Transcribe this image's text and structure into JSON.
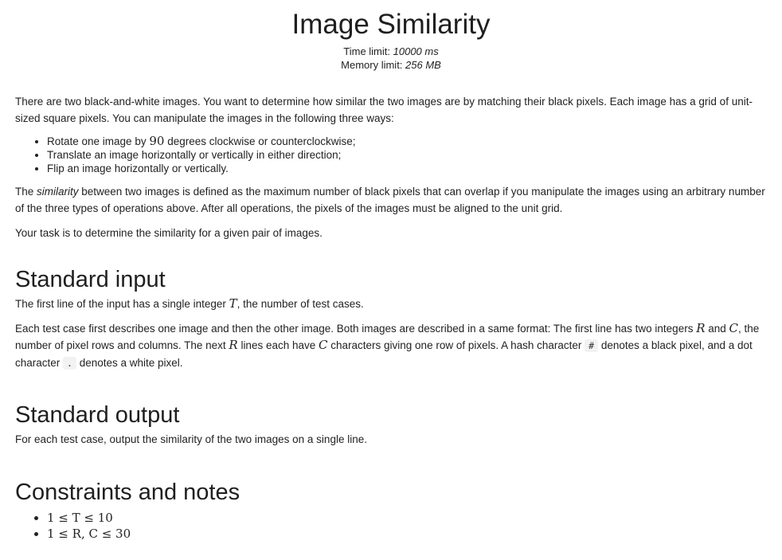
{
  "title": "Image Similarity",
  "limits": {
    "time_label": "Time limit: ",
    "time_value": "10000 ms",
    "memory_label": "Memory limit: ",
    "memory_value": "256 MB"
  },
  "intro": "There are two black-and-white images. You want to determine how similar the two images are by matching their black pixels. Each image has a grid of unit-sized square pixels. You can manipulate the images in the following three ways:",
  "operations": {
    "rotate_pre": "Rotate one image by ",
    "rotate_num": "90",
    "rotate_post": " degrees clockwise or counterclockwise;",
    "translate": "Translate an image horizontally or vertically in either direction;",
    "flip": "Flip an image horizontally or vertically."
  },
  "similarity": {
    "pre": "The ",
    "term": "similarity",
    "post": " between two images is defined as the maximum number of black pixels that can overlap if you manipulate the images using an arbitrary number of the three types of operations above. After all operations, the pixels of the images must be aligned to the unit grid."
  },
  "task": "Your task is to determine the similarity for a given pair of images.",
  "input_section": {
    "heading": "Standard input",
    "p1_pre": "The first line of the input has a single integer ",
    "p1_var": "T",
    "p1_post": ", the number of test cases.",
    "p2_a": "Each test case first describes one image and then the other image. Both images are described in a same format: The first line has two integers ",
    "var_R": "R",
    "p2_and": " and ",
    "var_C": "C",
    "p2_b": ", the number of pixel rows and columns. The next ",
    "p2_c": " lines each have ",
    "p2_d": " characters giving one row of pixels. A hash character ",
    "hash_code": "#",
    "p2_e": " denotes a black pixel, and a dot character ",
    "dot_code": ".",
    "p2_f": " denotes a white pixel."
  },
  "output_section": {
    "heading": "Standard output",
    "text": "For each test case, output the similarity of the two images on a single line."
  },
  "constraints_section": {
    "heading": "Constraints and notes",
    "items": [
      "1 ≤ T ≤ 10",
      "1 ≤ R, C ≤ 30"
    ]
  }
}
